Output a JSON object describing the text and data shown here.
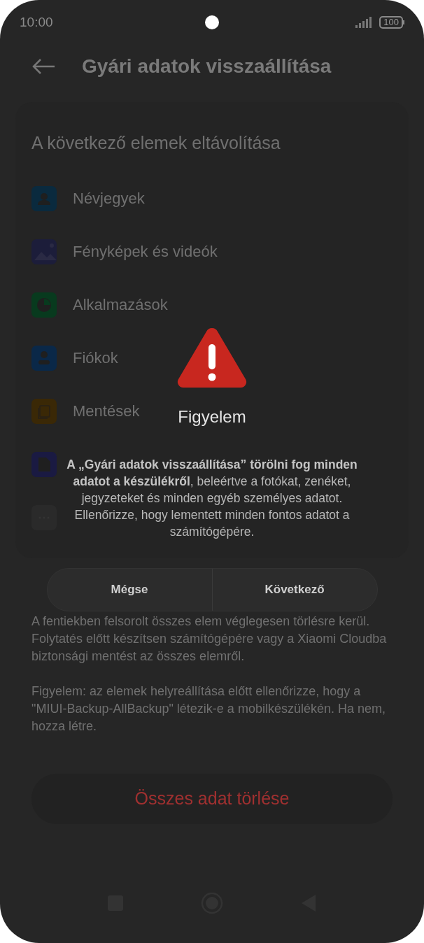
{
  "status_bar": {
    "time": "10:00",
    "battery": "100"
  },
  "header": {
    "title": "Gyári adatok visszaállítása"
  },
  "card": {
    "title": "A következő elemek eltávolítása",
    "items": [
      {
        "kind": "contacts",
        "label": "Névjegyek",
        "color": "#0a2a3e"
      },
      {
        "kind": "photos",
        "label": "Fényképek és videók",
        "color": "#1c1d3a"
      },
      {
        "kind": "apps",
        "label": "Alkalmazások",
        "color": "#083a1e"
      },
      {
        "kind": "accounts",
        "label": "Fiókok",
        "color": "#0a2848"
      },
      {
        "kind": "backups",
        "label": "Mentések",
        "color": "#3a2806"
      },
      {
        "kind": "sdcard",
        "color": "#1a1a42"
      },
      {
        "kind": "other",
        "color": "#2a2a2a"
      }
    ]
  },
  "paragraphs": [
    "A fentiekben felsorolt összes elem véglegesen törlésre kerül. Folytatés előtt készítsen számítógépére vagy a Xiaomi Cloudba biztonsági mentést az összes elemről.",
    "Figyelem: az elemek helyreállítása előtt ellenőrizze, hogy a \"MIUI-Backup-AllBackup\" létezik-e a mobilkészülékén. Ha nem, hozza létre."
  ],
  "erase_button": "Összes adat törlése",
  "dialog": {
    "title": "Figyelem",
    "message": "**A „Gyári adatok visszaállítása” törölni fog minden adatot a készülékről**, beleértve a fotókat, zenéket, jegyzeteket és minden egyéb személyes adatot. Ellenőrizze, hogy lementett minden fontos adatot a számítógépére.",
    "buttons": [
      "Mégse",
      "Következő"
    ]
  }
}
